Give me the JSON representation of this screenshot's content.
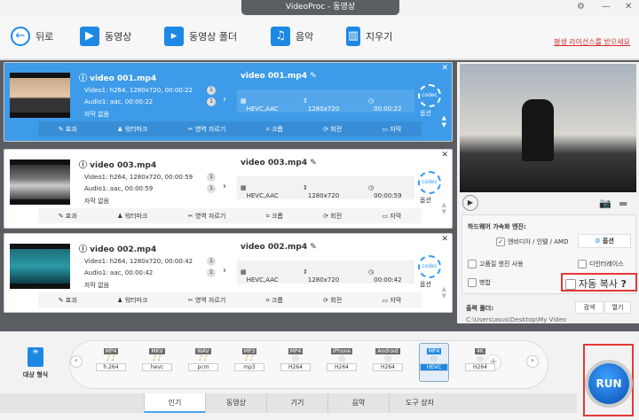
{
  "window": {
    "title": "VideoProc - 동영상"
  },
  "toolbar": {
    "back": "뒤로",
    "video": "동영상",
    "folder": "동영상 폴더",
    "music": "음악",
    "clear": "지우기",
    "license": "평생 라이선스를 받으세요"
  },
  "items": [
    {
      "name": "video 001.mp4",
      "video": "Video1: h264, 1280x720, 00:00:22",
      "audio": "Audio1: aac, 00:00:22",
      "subtitle": "자막 없음",
      "out_name": "video 001.mp4",
      "codec": "HEVC,AAC",
      "res": "1280x720",
      "dur": "00:00:22",
      "selected": true
    },
    {
      "name": "video 003.mp4",
      "video": "Video1: h264, 1280x720, 00:00:59",
      "audio": "Audio1: aac, 00:00:59",
      "subtitle": "자막 없음",
      "out_name": "video 003.mp4",
      "codec": "HEVC,AAC",
      "res": "1280x720",
      "dur": "00:00:59"
    },
    {
      "name": "video 002.mp4",
      "video": "Video1: h264, 1280x720, 00:00:42",
      "audio": "Audio1: aac, 00:00:42",
      "subtitle": "자막 없음",
      "out_name": "video 002.mp4",
      "codec": "HEVC,AAC",
      "res": "1280x720",
      "dur": "00:00:42"
    }
  ],
  "item_common": {
    "codec_label": "codec",
    "option": "옵션",
    "track_num": "1",
    "edits": [
      "효과",
      "워터마크",
      "영역 자르기",
      "크롭",
      "회전",
      "자막"
    ]
  },
  "settings": {
    "hw_title": "하드웨어 가속화 엔진:",
    "hw_option": "엔비디아 / 인텔 / AMD",
    "option_btn": "옵션",
    "hq": "고품질 엔진 사용",
    "deinterlace": "디인터레이스",
    "merge": "병합",
    "autocopy": "자동 복사",
    "help": "?",
    "output_label": "출력 폴더:",
    "browse": "검색",
    "open": "열기",
    "output_path": "C:\\Users\\asus\\Desktop\\My Video"
  },
  "target": {
    "label": "대상 형식"
  },
  "formats": [
    {
      "tag": "MP4",
      "sub": "h.264",
      "audio": true
    },
    {
      "tag": "MKV",
      "sub": "hevc",
      "audio": true
    },
    {
      "tag": "WAV",
      "sub": "pcm",
      "audio": true
    },
    {
      "tag": "MP3",
      "sub": "mp3",
      "audio": true
    },
    {
      "tag": "MP4",
      "sub": "H264"
    },
    {
      "tag": "iPhone",
      "sub": "H264"
    },
    {
      "tag": "Android",
      "sub": "H264"
    },
    {
      "tag": "MP4",
      "sub": "HEVC",
      "selected": true
    },
    {
      "tag": "4K",
      "sub": "H264"
    }
  ],
  "tabs": [
    "인기",
    "동영상",
    "기기",
    "음악",
    "도구 상자"
  ],
  "run": "RUN"
}
